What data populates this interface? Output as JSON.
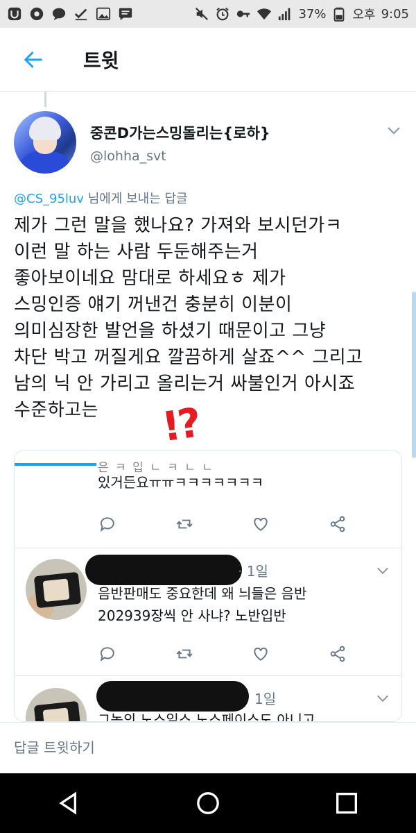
{
  "status_bar": {
    "battery": "37%",
    "ampm": "오후",
    "time": "9:05",
    "icons": [
      "app-icon",
      "record-icon",
      "chat-icon",
      "check-icon",
      "image-icon",
      "message-icon",
      "mute-icon",
      "alarm-icon",
      "key-icon",
      "wifi-icon",
      "signal-icon",
      "battery-icon"
    ]
  },
  "header": {
    "title": "트윗"
  },
  "tweet": {
    "author_name": "중콘D가는스밍돌리는{로하}",
    "author_handle": "@lohha_svt",
    "reply_to_mention": "@CS_95luv",
    "reply_to_suffix": " 님에게 보내는 답글",
    "lines": [
      "제가 그런 말을 했나요? 가져와 보시던가ㅋ",
      "이런 말 하는 사람 두둔해주는거",
      "좋아보이네요 맘대로 하세요ㅎ 제가",
      "스밍인증 얘기 꺼낸건 충분히 이분이",
      "의미심장한 발언을 하셨기 때문이고 그냥",
      "차단 박고 꺼질게요 깔끔하게 살죠^^ 그리고",
      "남의 닉 안 가리고 올리는거 싸불인거 아시죠",
      "수준하고는"
    ],
    "sticker": "!?"
  },
  "embedded": {
    "cut_line": "은 ㅋ 입 ㄴ ㅋ ㄴ ㄴ",
    "first_text": "있거든요ㅠㅠㅋㅋㅋㅋㅋㅋㅋ",
    "replies": [
      {
        "time": "· 1일",
        "lines": [
          "음반판매도 중요한데 왜 늬들은 음반",
          "202939장씩 안 사냐? 노반입반"
        ]
      },
      {
        "time": "1일",
        "lines": [
          "그놈의 노스일스 노스페이스도 아니고"
        ]
      }
    ]
  },
  "compose": {
    "placeholder": "답글 트윗하기"
  },
  "colors": {
    "accent": "#1da1f2",
    "sticker": "#e31b23",
    "muted": "#657786"
  }
}
